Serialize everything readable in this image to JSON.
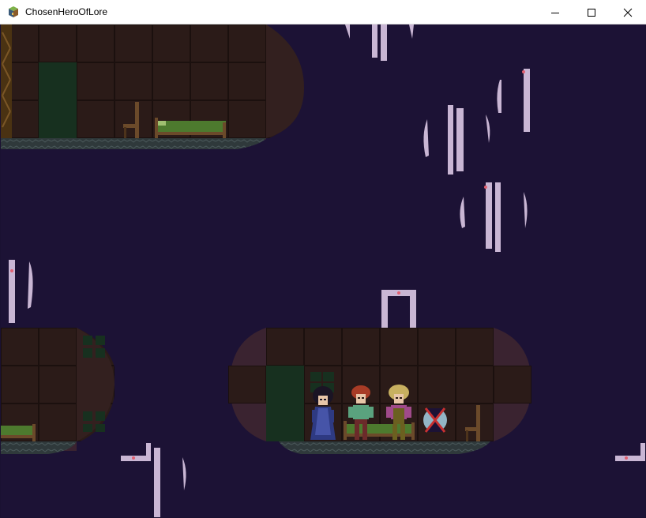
{
  "window": {
    "title": "ChosenHeroOfLore",
    "icon": "game-cube-icon",
    "controls": [
      "minimize-icon",
      "maximize-icon",
      "close-icon"
    ]
  },
  "colors": {
    "sky": "#1c1235",
    "wall_tile": "#2b1b18",
    "wall_line": "#1b100e",
    "door": "#17301f",
    "floor": "#3a4748",
    "bed_sheet": "#4d7a2e",
    "bed_frame": "#6b4a2a",
    "crystal": "#c9b6d4",
    "ghost_bubble": "#3a2330"
  },
  "scene": {
    "characters": [
      {
        "name": "dark-haired woman in blue robe",
        "icon": "mage-character"
      },
      {
        "name": "red-haired hero in green shirt",
        "icon": "hero-character"
      },
      {
        "name": "blond villager with overalls",
        "icon": "villager-character"
      }
    ],
    "status_marker": "hourglass-cross-icon"
  }
}
